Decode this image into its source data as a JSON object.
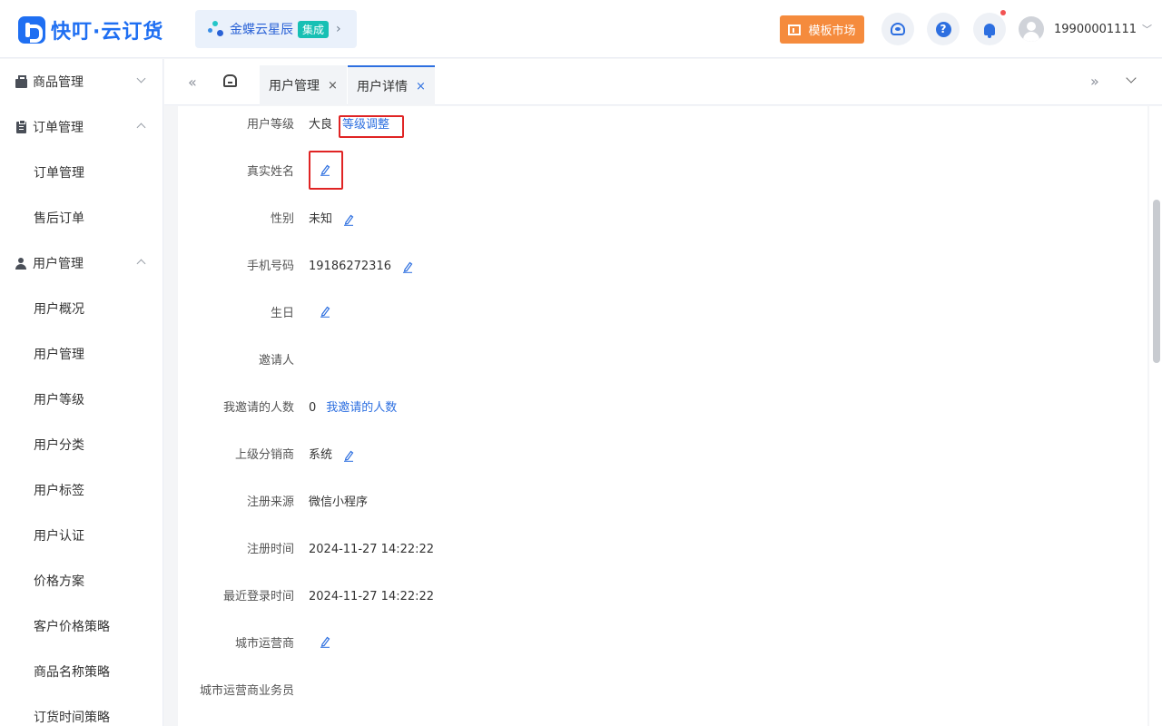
{
  "app": {
    "logo_text": "快叮·云订货"
  },
  "integration": {
    "name": "金蝶云星辰",
    "tag": "集成",
    "chevron": "›"
  },
  "header": {
    "template_market": "模板市场",
    "icons": [
      "support-icon",
      "help-icon",
      "bell-icon"
    ],
    "help_glyph": "?",
    "username": "19900001111",
    "user_chevron": "﹀"
  },
  "sidebar": {
    "groups": [
      {
        "label": "商品管理",
        "icon": "shopping-bag-icon",
        "expanded": false
      },
      {
        "label": "订单管理",
        "icon": "clipboard-icon",
        "expanded": true,
        "items": [
          "订单管理",
          "售后订单"
        ]
      },
      {
        "label": "用户管理",
        "icon": "person-icon",
        "expanded": true,
        "items": [
          "用户概况",
          "用户管理",
          "用户等级",
          "用户分类",
          "用户标签",
          "用户认证",
          "价格方案",
          "客户价格策略",
          "商品名称策略",
          "订货时间策略"
        ]
      }
    ]
  },
  "tabs": {
    "prev": "«",
    "next": "»",
    "items": [
      {
        "label": "用户管理",
        "close": "×",
        "active": false
      },
      {
        "label": "用户详情",
        "close": "×",
        "active": true
      }
    ]
  },
  "detail": {
    "level": {
      "label": "用户等级",
      "value": "大良",
      "action": "等级调整"
    },
    "real_name": {
      "label": "真实姓名",
      "value": ""
    },
    "gender": {
      "label": "性别",
      "value": "未知"
    },
    "phone": {
      "label": "手机号码",
      "value": "19186272316"
    },
    "birthday": {
      "label": "生日",
      "value": ""
    },
    "inviter": {
      "label": "邀请人",
      "value": ""
    },
    "invited_count": {
      "label": "我邀请的人数",
      "value": "0",
      "action": "我邀请的人数"
    },
    "parent_distributor": {
      "label": "上级分销商",
      "value": "系统"
    },
    "register_source": {
      "label": "注册来源",
      "value": "微信小程序"
    },
    "register_time": {
      "label": "注册时间",
      "value": "2024-11-27 14:22:22"
    },
    "last_login": {
      "label": "最近登录时间",
      "value": "2024-11-27 14:22:22"
    },
    "city_operator": {
      "label": "城市运营商",
      "value": ""
    },
    "city_operator_staff": {
      "label": "城市运营商业务员",
      "value": ""
    }
  },
  "colors": {
    "brand": "#1f6ff2",
    "link": "#2d6fe0",
    "template_button": "#f58b3d",
    "highlight": "#e02424"
  }
}
